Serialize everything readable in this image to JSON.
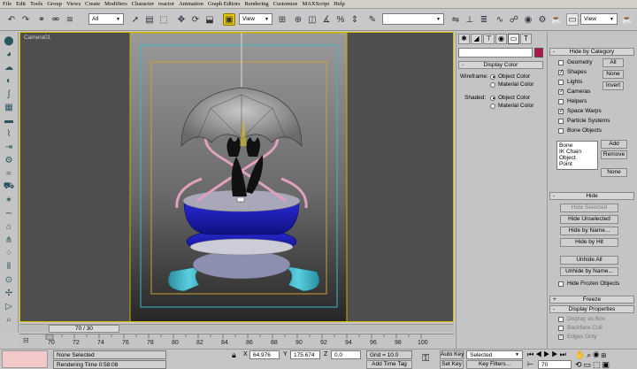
{
  "menu": [
    "File",
    "Edit",
    "Tools",
    "Group",
    "Views",
    "Create",
    "Modifiers",
    "Character",
    "reactor",
    "Animation",
    "Graph Editors",
    "Rendering",
    "Customize",
    "MAXScript",
    "Help"
  ],
  "toolbar": {
    "selection_filter": "All",
    "coord_system": "View",
    "coord_system_right": "View"
  },
  "viewport": {
    "label": "Camera01"
  },
  "frame": {
    "counter": "70 / 30"
  },
  "timeline": {
    "ticks": [
      "70",
      "72",
      "74",
      "76",
      "78",
      "80",
      "82",
      "84",
      "86",
      "88",
      "90",
      "92",
      "94",
      "96",
      "98",
      "100"
    ]
  },
  "status": {
    "selection": "None Selected",
    "render_time": "Rendering Time  0:58:08",
    "x_label": "X",
    "x_value": "64.976",
    "y_label": "Y",
    "y_value": "175.674",
    "z_label": "Z",
    "z_value": "0.0",
    "grid": "Grid = 10.0",
    "add_time_tag": "Add Time Tag",
    "auto_key": "Auto Key",
    "auto_key_value": "Selected",
    "set_key": "Set Key",
    "key_filters": "Key Filters...",
    "current_frame": "70"
  },
  "display_color": {
    "title": "Display Color",
    "wireframe_label": "Wireframe:",
    "shaded_label": "Shaded:",
    "object_color": "Object Color",
    "material_color": "Material Color"
  },
  "hide_by_category": {
    "title": "Hide by Category",
    "items": [
      {
        "label": "Geometry",
        "checked": false
      },
      {
        "label": "Shapes",
        "checked": true
      },
      {
        "label": "Lights",
        "checked": false
      },
      {
        "label": "Cameras",
        "checked": true
      },
      {
        "label": "Helpers",
        "checked": false
      },
      {
        "label": "Space Warps",
        "checked": true
      },
      {
        "label": "Particle Systems",
        "checked": false
      },
      {
        "label": "Bone Objects",
        "checked": false
      }
    ],
    "all": "All",
    "none": "None",
    "invert": "Invert",
    "list": [
      "Bone",
      "IK Chain Object",
      "Point"
    ],
    "add": "Add",
    "remove": "Remove",
    "none2": "None"
  },
  "hide": {
    "title": "Hide",
    "hide_selected": "Hide Selected",
    "hide_unselected": "Hide Unselected",
    "hide_by_name": "Hide by Name...",
    "hide_by_hit": "Hide by Hit",
    "unhide_all": "Unhide All",
    "unhide_by_name": "Unhide by Name...",
    "hide_frozen": "Hide Frozen Objects"
  },
  "freeze": {
    "title": "Freeze"
  },
  "display_properties": {
    "title": "Display Properties",
    "items": [
      "Display as Box",
      "Backface Cull",
      "Edges Only"
    ]
  },
  "colors": {
    "accent": "#d8c000",
    "swatch": "#b0154a",
    "vase_blue": "#1c1cc4",
    "base_cyan": "#3bb6c8",
    "pink": "#e0a0c0"
  }
}
